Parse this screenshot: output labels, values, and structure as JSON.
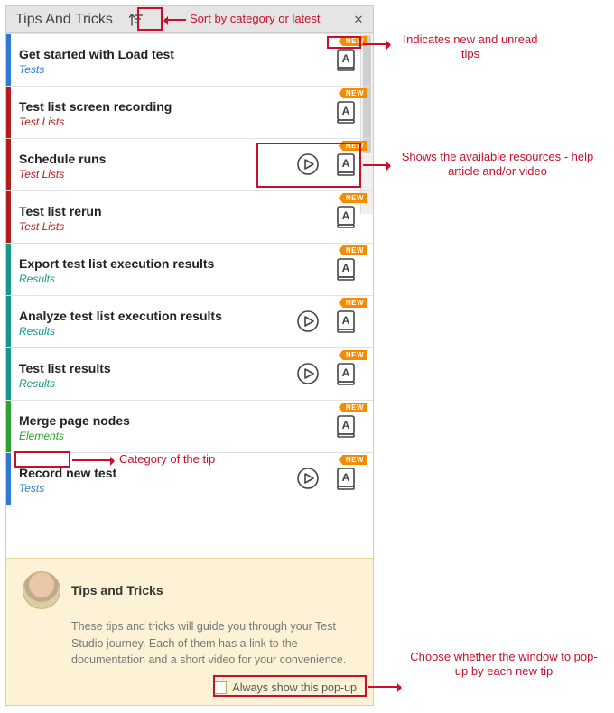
{
  "header": {
    "title": "Tips And Tricks",
    "close_glyph": "✕"
  },
  "badge_label": "NEW",
  "tips": [
    {
      "title": "Get started with Load test",
      "category": "Tests",
      "color": "blue",
      "has_video": false,
      "has_article": true,
      "is_new": true
    },
    {
      "title": "Test list screen recording",
      "category": "Test Lists",
      "color": "red",
      "has_video": false,
      "has_article": true,
      "is_new": true
    },
    {
      "title": "Schedule runs",
      "category": "Test Lists",
      "color": "red",
      "has_video": true,
      "has_article": true,
      "is_new": true
    },
    {
      "title": "Test list rerun",
      "category": "Test Lists",
      "color": "red",
      "has_video": false,
      "has_article": true,
      "is_new": true
    },
    {
      "title": "Export test list execution results",
      "category": "Results",
      "color": "teal",
      "has_video": false,
      "has_article": true,
      "is_new": true
    },
    {
      "title": "Analyze test list execution results",
      "category": "Results",
      "color": "teal",
      "has_video": true,
      "has_article": true,
      "is_new": true
    },
    {
      "title": "Test list results",
      "category": "Results",
      "color": "teal",
      "has_video": true,
      "has_article": true,
      "is_new": true
    },
    {
      "title": "Merge page nodes",
      "category": "Elements",
      "color": "green",
      "has_video": false,
      "has_article": true,
      "is_new": true
    },
    {
      "title": "Record new test",
      "category": "Tests",
      "color": "blue",
      "has_video": true,
      "has_article": true,
      "is_new": true
    }
  ],
  "footer": {
    "title": "Tips and Tricks",
    "body": "These tips and tricks will guide you through your Test Studio journey. Each of them has a link to the documentation and a short video for your convenience.",
    "always_show_label": "Always show this pop-up",
    "always_show_checked": false
  },
  "annotations": {
    "sort": "Sort by category or latest",
    "new": "Indicates new and unread tips",
    "resources": "Shows the available resources - help article and/or video",
    "category": "Category of the tip",
    "popup": "Choose whether the window to pop-up by each new tip"
  }
}
